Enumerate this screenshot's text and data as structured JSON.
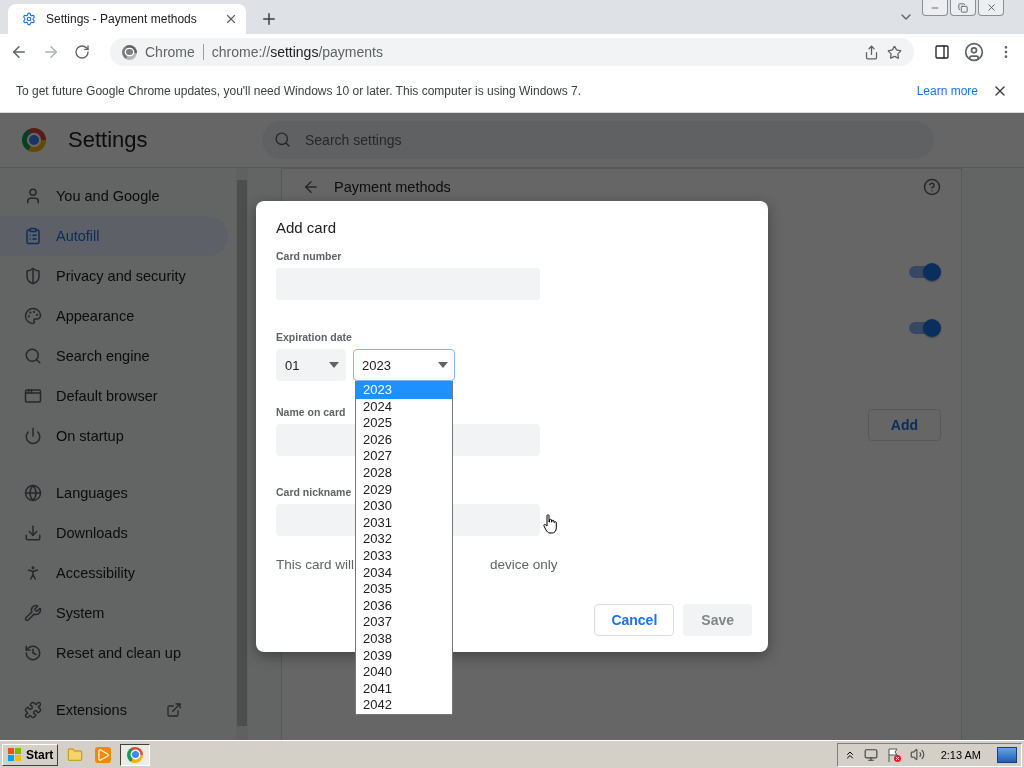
{
  "browser": {
    "tab": {
      "title": "Settings - Payment methods"
    },
    "nav": {
      "forward_disabled": true
    },
    "omnibox": {
      "site_label": "Chrome",
      "url": {
        "scheme": "chrome://",
        "host": "settings",
        "path": "/payments"
      }
    }
  },
  "infobar": {
    "message": "To get future Google Chrome updates, you'll need Windows 10 or later. This computer is using Windows 7.",
    "link": "Learn more"
  },
  "settings": {
    "title": "Settings",
    "search": {
      "placeholder": "Search settings"
    },
    "sidebar": {
      "sections": [
        {
          "items": [
            {
              "label": "You and Google",
              "selected": false
            },
            {
              "label": "Autofill",
              "selected": true
            },
            {
              "label": "Privacy and security",
              "selected": false
            },
            {
              "label": "Appearance",
              "selected": false
            },
            {
              "label": "Search engine",
              "selected": false
            },
            {
              "label": "Default browser",
              "selected": false
            },
            {
              "label": "On startup",
              "selected": false
            }
          ]
        },
        {
          "items": [
            {
              "label": "Languages",
              "selected": false
            },
            {
              "label": "Downloads",
              "selected": false
            },
            {
              "label": "Accessibility",
              "selected": false
            },
            {
              "label": "System",
              "selected": false
            },
            {
              "label": "Reset and clean up",
              "selected": false
            }
          ]
        },
        {
          "items": [
            {
              "label": "Extensions",
              "selected": false
            }
          ]
        }
      ]
    },
    "page": {
      "title": "Payment methods",
      "toggles": [
        {
          "on": true
        },
        {
          "on": true
        }
      ],
      "add_button": "Add"
    }
  },
  "dialog": {
    "title": "Add card",
    "card_number": {
      "label": "Card number"
    },
    "expiration": {
      "label": "Expiration date",
      "month": {
        "value": "01"
      },
      "year": {
        "value": "2023",
        "expanded": true,
        "options": [
          {
            "label": "2023",
            "selected": true
          },
          {
            "label": "2024",
            "selected": false
          },
          {
            "label": "2025",
            "selected": false
          },
          {
            "label": "2026",
            "selected": false
          },
          {
            "label": "2027",
            "selected": false
          },
          {
            "label": "2028",
            "selected": false
          },
          {
            "label": "2029",
            "selected": false
          },
          {
            "label": "2030",
            "selected": false
          },
          {
            "label": "2031",
            "selected": false
          },
          {
            "label": "2032",
            "selected": false
          },
          {
            "label": "2033",
            "selected": false
          },
          {
            "label": "2034",
            "selected": false
          },
          {
            "label": "2035",
            "selected": false
          },
          {
            "label": "2036",
            "selected": false
          },
          {
            "label": "2037",
            "selected": false
          },
          {
            "label": "2038",
            "selected": false
          },
          {
            "label": "2039",
            "selected": false
          },
          {
            "label": "2040",
            "selected": false
          },
          {
            "label": "2041",
            "selected": false
          },
          {
            "label": "2042",
            "selected": false
          }
        ]
      }
    },
    "name_on_card": {
      "label": "Name on card"
    },
    "nickname": {
      "label": "Card nickname"
    },
    "note_parts": [
      "This card will",
      "device only"
    ],
    "cancel": {
      "label": "Cancel"
    },
    "save": {
      "label": "Save",
      "disabled": true
    }
  },
  "taskbar": {
    "start": "Start",
    "clock": "2:13 AM"
  }
}
